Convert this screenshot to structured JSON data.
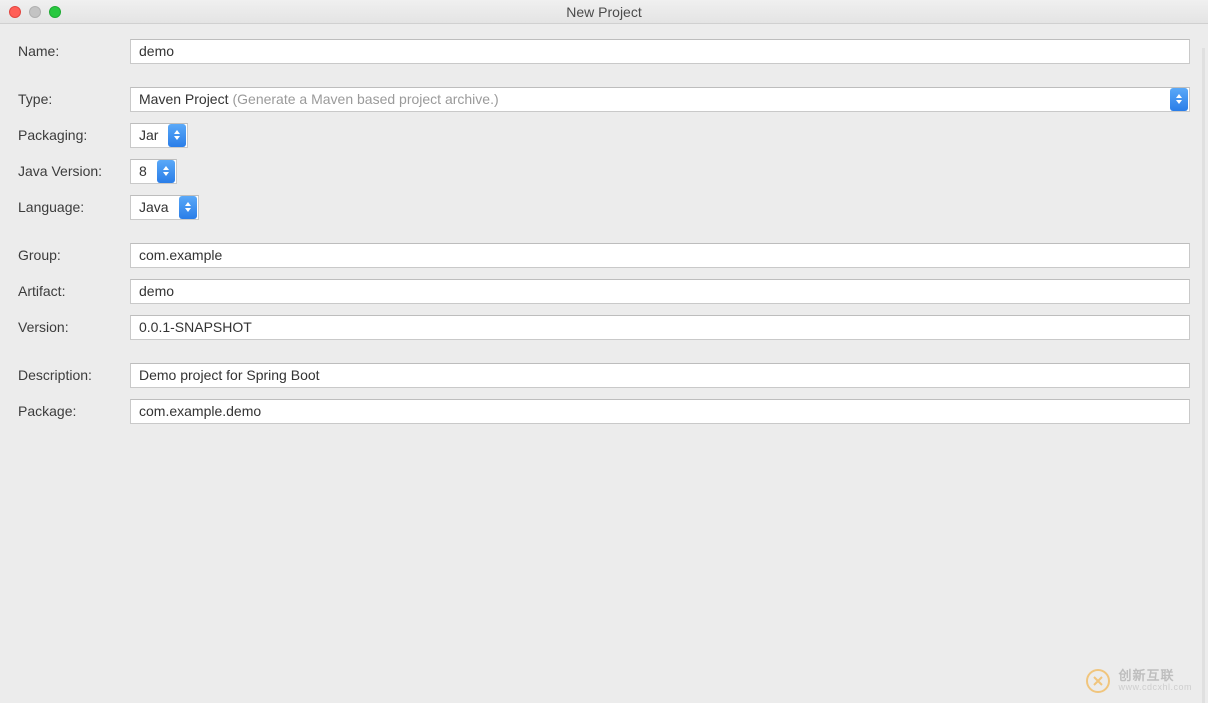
{
  "window": {
    "title": "New Project"
  },
  "labels": {
    "name": "Name:",
    "type": "Type:",
    "packaging": "Packaging:",
    "java_version": "Java Version:",
    "language": "Language:",
    "group": "Group:",
    "artifact": "Artifact:",
    "version": "Version:",
    "description": "Description:",
    "package": "Package:"
  },
  "values": {
    "name": "demo",
    "type": "Maven Project",
    "type_hint": "(Generate a Maven based project archive.)",
    "packaging": "Jar",
    "java_version": "8",
    "language": "Java",
    "group": "com.example",
    "artifact": "demo",
    "version": "0.0.1-SNAPSHOT",
    "description": "Demo project for Spring Boot",
    "package": "com.example.demo"
  },
  "watermark": {
    "cn": "创新互联",
    "en": "www.cdcxhl.com"
  }
}
